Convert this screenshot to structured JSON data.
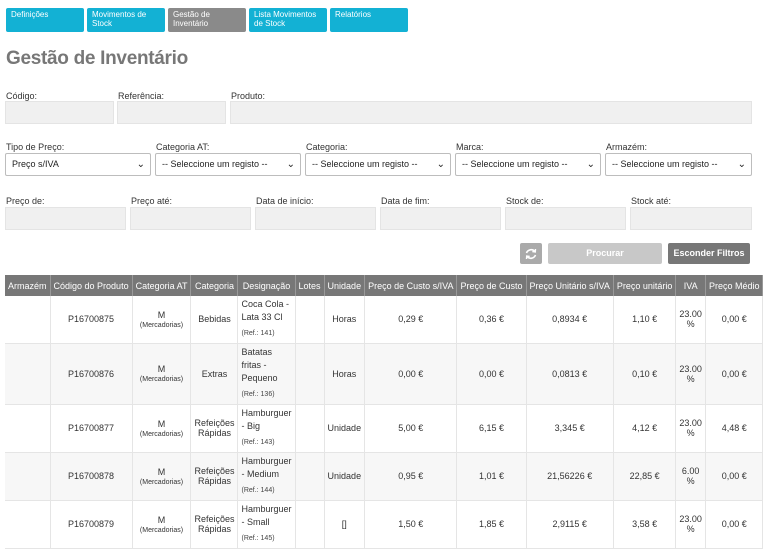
{
  "tabs": [
    {
      "label": "Definições",
      "active": false
    },
    {
      "label": "Movimentos de Stock",
      "active": false
    },
    {
      "label": "Gestão de Inventário",
      "active": true
    },
    {
      "label": "Lista Movimentos de Stock",
      "active": false
    },
    {
      "label": "Relatórios",
      "active": false
    }
  ],
  "page_title": "Gestão de Inventário",
  "filters": {
    "codigo": "Código:",
    "referencia": "Referência:",
    "produto": "Produto:",
    "tipo_preco": {
      "label": "Tipo de Preço:",
      "value": "Preço s/IVA"
    },
    "categoria_at": {
      "label": "Categoria AT:",
      "value": "-- Seleccione um registo --"
    },
    "categoria": {
      "label": "Categoria:",
      "value": "-- Seleccione um registo --"
    },
    "marca": {
      "label": "Marca:",
      "value": "-- Seleccione um registo --"
    },
    "armazem": {
      "label": "Armazém:",
      "value": "-- Seleccione um registo --"
    },
    "preco_de": "Preço de:",
    "preco_ate": "Preço até:",
    "data_inicio": "Data de início:",
    "data_fim": "Data de fim:",
    "stock_de": "Stock de:",
    "stock_ate": "Stock até:"
  },
  "buttons": {
    "search": "Procurar",
    "hide_filters": "Esconder Filtros",
    "refresh_icon": "refresh-icon"
  },
  "table": {
    "headers": [
      "Armazém",
      "Código do Produto",
      "Categoria AT",
      "Categoria",
      "Designação",
      "Lotes",
      "Unidade",
      "Preço de Custo s/IVA",
      "Preço de Custo",
      "Preço Unitário s/IVA",
      "Preço unitário",
      "IVA",
      "Preço Médio"
    ],
    "rows": [
      {
        "armazem": "",
        "codigo": "P16700875",
        "cat_at": "M",
        "cat_at_sub": "(Mercadorias)",
        "categoria": "Bebidas",
        "designacao": "Coca Cola - Lata 33 Cl",
        "ref": "(Ref.: 141)",
        "lotes": "",
        "unidade": "Horas",
        "custo_siva": "0,29 €",
        "custo": "0,36 €",
        "unit_siva": "0,8934 €",
        "unit": "1,10 €",
        "iva": "23.00 %",
        "medio": "0,00 €"
      },
      {
        "armazem": "",
        "codigo": "P16700876",
        "cat_at": "M",
        "cat_at_sub": "(Mercadorias)",
        "categoria": "Extras",
        "designacao": "Batatas fritas - Pequeno",
        "ref": "(Ref.: 136)",
        "lotes": "",
        "unidade": "Horas",
        "custo_siva": "0,00 €",
        "custo": "0,00 €",
        "unit_siva": "0,0813 €",
        "unit": "0,10 €",
        "iva": "23.00 %",
        "medio": "0,00 €"
      },
      {
        "armazem": "",
        "codigo": "P16700877",
        "cat_at": "M",
        "cat_at_sub": "(Mercadorias)",
        "categoria": "Refeições Rápidas",
        "designacao": "Hamburguer - Big",
        "ref": "(Ref.: 143)",
        "lotes": "",
        "unidade": "Unidade",
        "custo_siva": "5,00 €",
        "custo": "6,15 €",
        "unit_siva": "3,345 €",
        "unit": "4,12 €",
        "iva": "23.00 %",
        "medio": "4,48 €"
      },
      {
        "armazem": "",
        "codigo": "P16700878",
        "cat_at": "M",
        "cat_at_sub": "(Mercadorias)",
        "categoria": "Refeições Rápidas",
        "designacao": "Hamburguer - Medium",
        "ref": "(Ref.: 144)",
        "lotes": "",
        "unidade": "Unidade",
        "custo_siva": "0,95 €",
        "custo": "1,01 €",
        "unit_siva": "21,56226 €",
        "unit": "22,85 €",
        "iva": "6.00 %",
        "medio": "0,00 €"
      },
      {
        "armazem": "",
        "codigo": "P16700879",
        "cat_at": "M",
        "cat_at_sub": "(Mercadorias)",
        "categoria": "Refeições Rápidas",
        "designacao": "Hamburguer - Small",
        "ref": "(Ref.: 145)",
        "lotes": "",
        "unidade": "[]",
        "custo_siva": "1,50 €",
        "custo": "1,85 €",
        "unit_siva": "2,9115 €",
        "unit": "3,58 €",
        "iva": "23.00 %",
        "medio": "0,00 €"
      }
    ]
  }
}
